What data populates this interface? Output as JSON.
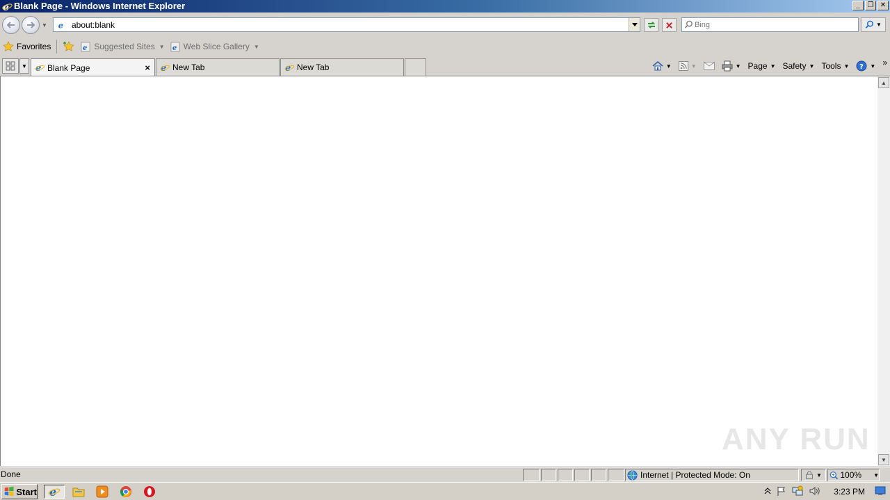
{
  "window": {
    "title": "Blank Page - Windows Internet Explorer",
    "buttons": {
      "minimize": "_",
      "restore": "❐",
      "close": "✕"
    }
  },
  "address_bar": {
    "url": "about:blank",
    "search_placeholder": "Bing"
  },
  "favorites_bar": {
    "favorites_label": "Favorites",
    "items": [
      {
        "label": "Suggested Sites",
        "icon": "ie-page-icon"
      },
      {
        "label": "Web Slice Gallery",
        "icon": "ie-page-icon"
      }
    ]
  },
  "tabs": [
    {
      "label": "Blank Page",
      "active": true,
      "close": "×"
    },
    {
      "label": "New Tab",
      "active": false
    },
    {
      "label": "New Tab",
      "active": false
    }
  ],
  "command_bar": {
    "items": [
      {
        "label": "Page"
      },
      {
        "label": "Safety"
      },
      {
        "label": "Tools"
      }
    ],
    "more": "»"
  },
  "status_bar": {
    "status_text": "Done",
    "zone_text": "Internet | Protected Mode: On",
    "zoom_text": "100%"
  },
  "watermark": {
    "text": "ANY RUN"
  },
  "taskbar": {
    "start_label": "Start",
    "clock": "3:23 PM"
  },
  "colors": {
    "chrome": "#d6d3ce",
    "titlebar_start": "#0a246a",
    "titlebar_end": "#a6caf0",
    "ie_blue": "#1e6bc6",
    "chrome_accent": "#e8b31b"
  }
}
